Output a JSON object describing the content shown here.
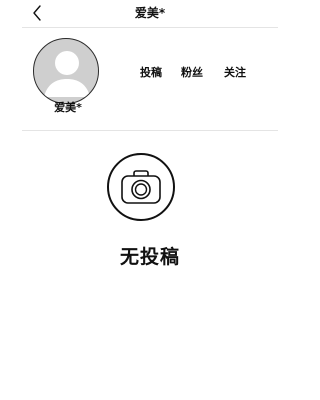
{
  "header": {
    "back_icon": "chevron-left-icon",
    "title": "爱美*"
  },
  "profile": {
    "avatar_icon": "default-user-icon",
    "username": "爱美*",
    "stats": [
      {
        "label": "投稿"
      },
      {
        "label": "粉丝"
      },
      {
        "label": "关注"
      }
    ]
  },
  "empty_state": {
    "icon": "camera-icon",
    "text": "无投稿"
  },
  "colors": {
    "background": "#ffffff",
    "text": "#111111",
    "divider": "#e4e4e4",
    "avatar_bg": "#cfcfcf"
  }
}
